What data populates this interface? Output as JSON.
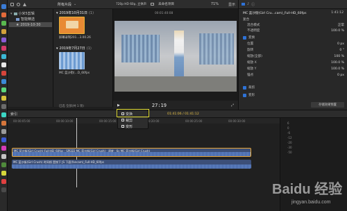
{
  "libraries": {
    "items": [
      {
        "label": "小米5剪辑"
      },
      {
        "label": "智能精选"
      },
      {
        "label": "2019-10-30"
      }
    ]
  },
  "browser": {
    "filter_label": "所有片段",
    "group1_date": "2019年10月31日",
    "group1_count": "(1)",
    "clip1_label": "屏幕录制201...3.00.26",
    "group2_date": "2019年7月27日",
    "group2_count": "(1)",
    "clip2_label": "MC 蓝沙街(...D_60fps",
    "status_text": "已选 全部(共 1 项)"
  },
  "viewer": {
    "format_label": "720p HD 60p, 立体声",
    "project_label": "未命名项目",
    "zoom_label": "71%",
    "view_label": "显示",
    "left_time": "00:01:40:08",
    "timecode": "27:19"
  },
  "inspector": {
    "clip_name": "MC 蓝沙街(Girl Cru...cam)_Full-HD_60fps",
    "duration": "1:41:12",
    "sections": [
      {
        "label": "复合",
        "value": ""
      },
      {
        "label": "混合模式",
        "value": "正常"
      },
      {
        "label": "不透明度",
        "value": "100.0 %"
      },
      {
        "label": "变换",
        "value": ""
      },
      {
        "label": "位置",
        "value": "0 px"
      },
      {
        "label": "旋转",
        "value": "0 °"
      },
      {
        "label": "缩放(全部)",
        "value": "100 %"
      },
      {
        "label": "缩放 X",
        "value": "100.0 %"
      },
      {
        "label": "缩放 Y",
        "value": "100.0 %"
      },
      {
        "label": "锚点",
        "value": "0 px"
      },
      {
        "label": "裁剪",
        "value": ""
      },
      {
        "label": "变形",
        "value": ""
      }
    ],
    "save_button": "存储效果预置"
  },
  "timeline": {
    "index_label": "索引",
    "timecode_display": "01:41:06 / 01:41:12",
    "clip_upper_title": "MC 蓝沙街(Girl Crush)·Full-HD_60fps - SPEED  MC 蓝沙街(Girl Crush) · 速度 · 6s  MC 蓝沙街(Girl Crush)",
    "clip_lower_title": "MC 蓝沙街(Girl Crush) 时间线 是按下 JS 下面(fancam)_Full-HD_60fps",
    "ruler": [
      "00:00:05:00",
      "00:00:10:00",
      "00:00:15:00",
      "00:00:20:00",
      "00:00:25:00",
      "00:00:30:00"
    ]
  },
  "menu": {
    "items": [
      {
        "label": "变换"
      },
      {
        "label": "裁剪"
      },
      {
        "label": "变形"
      }
    ]
  },
  "audio": {
    "scale": [
      "6",
      "0",
      "-6",
      "-12",
      "-20",
      "-30",
      "-50"
    ]
  },
  "watermark": {
    "text": "Baidu 经验",
    "url": "jingyan.baidu.com"
  }
}
